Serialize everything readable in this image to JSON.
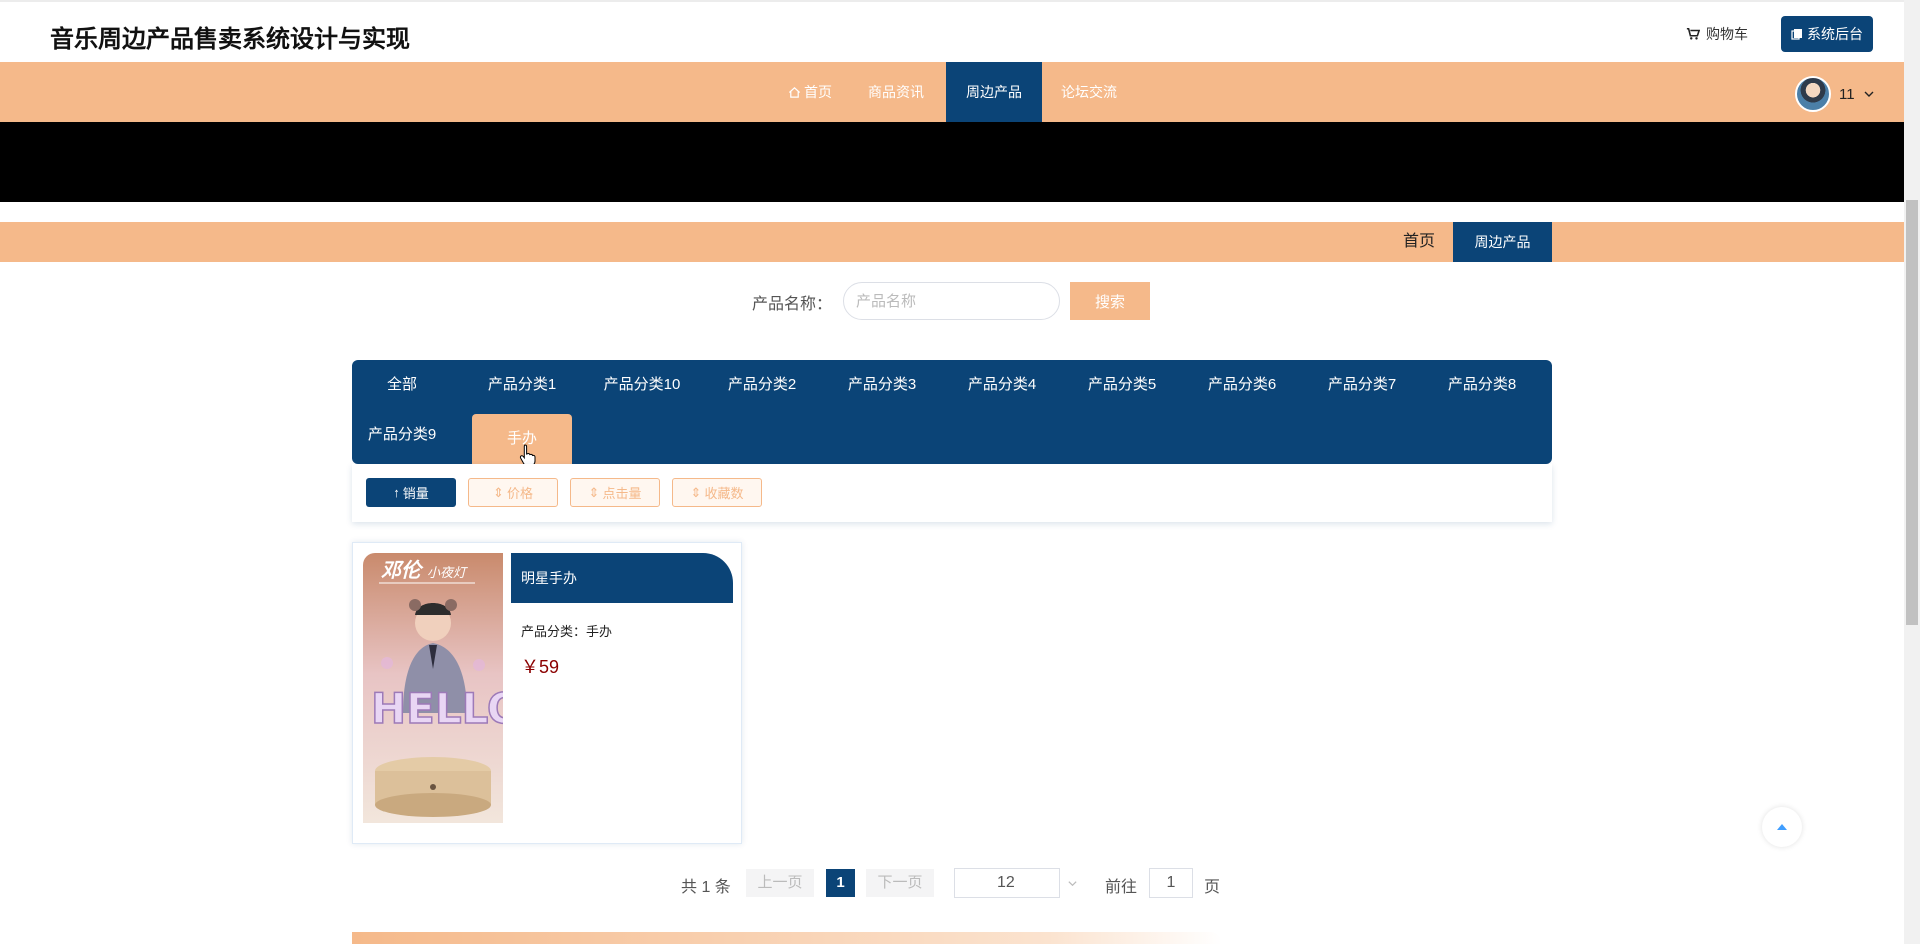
{
  "header": {
    "site_title": "音乐周边产品售卖系统设计与实现",
    "cart_label": "购物车",
    "admin_label": "系统后台"
  },
  "nav": {
    "items": [
      {
        "label": "首页",
        "icon": "home-icon"
      },
      {
        "label": "商品资讯"
      },
      {
        "label": "周边产品",
        "active": true
      },
      {
        "label": "论坛交流"
      }
    ],
    "user_name": "11"
  },
  "breadcrumb": {
    "home": "首页",
    "current": "周边产品"
  },
  "search": {
    "label": "产品名称：",
    "placeholder": "产品名称",
    "button": "搜索"
  },
  "categories": [
    "全部",
    "产品分类1",
    "产品分类10",
    "产品分类2",
    "产品分类3",
    "产品分类4",
    "产品分类5",
    "产品分类6",
    "产品分类7",
    "产品分类8",
    "产品分类9",
    "手办"
  ],
  "active_category": "手办",
  "sort": [
    {
      "label": "销量",
      "icon": "sort-up-icon",
      "active": true
    },
    {
      "label": "价格",
      "icon": "sort-both-icon"
    },
    {
      "label": "点击量",
      "icon": "sort-both-icon"
    },
    {
      "label": "收藏数",
      "icon": "sort-both-icon"
    }
  ],
  "products": [
    {
      "name": "明星手办",
      "category": "产品分类：手办",
      "price": "￥59",
      "image_text": {
        "title": "邓伦",
        "subtitle": "小夜灯",
        "word": "HELLO"
      }
    }
  ],
  "pagination": {
    "total": "共 1 条",
    "prev": "上一页",
    "page": "1",
    "next": "下一页",
    "page_size": "12",
    "goto": "前往",
    "goto_value": "1",
    "suffix": "页"
  },
  "colors": {
    "primary": "#0b4477",
    "accent": "#f5b98a",
    "price": "#8b0000"
  }
}
